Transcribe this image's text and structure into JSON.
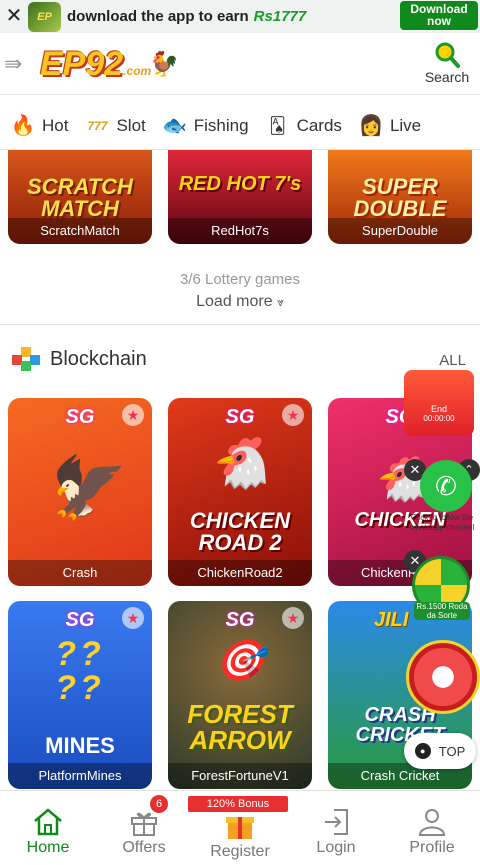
{
  "banner": {
    "close": "✕",
    "app_logo": "EP",
    "text": "download the app to earn",
    "amount": "Rs1777",
    "download": "Download now"
  },
  "header": {
    "logo": "EP92",
    "logo_suffix": ".com",
    "search_label": "Search"
  },
  "categories": [
    {
      "label": "Hot",
      "icon": "flame-icon"
    },
    {
      "label": "Slot",
      "icon": "777-icon"
    },
    {
      "label": "Fishing",
      "icon": "fish-icon"
    },
    {
      "label": "Cards",
      "icon": "cards-icon"
    },
    {
      "label": "Live",
      "icon": "live-dealer-icon"
    }
  ],
  "lottery": {
    "games": [
      {
        "name": "ScratchMatch",
        "art": "SCRATCH MATCH",
        "color": "#c23a0d"
      },
      {
        "name": "RedHot7s",
        "art": "RED HOT 7's",
        "color": "#b5121b"
      },
      {
        "name": "SuperDouble",
        "art": "SUPER DOUBLE",
        "color": "#d04a0a"
      }
    ],
    "count": "3/6 Lottery games",
    "load_more": "Load more"
  },
  "blockchain": {
    "title": "Blockchain",
    "all": "ALL",
    "row1": [
      {
        "name": "Crash",
        "badge": "SG",
        "art": "",
        "color": "#f05a1a"
      },
      {
        "name": "ChickenRoad2",
        "badge": "SG",
        "art": "CHICKEN ROAD 2",
        "color": "#d02a18"
      },
      {
        "name": "ChickenRoad",
        "badge": "SG",
        "art": "CHICKEN",
        "color": "#e0206a"
      }
    ],
    "row2": [
      {
        "name": "PlatformMines",
        "badge": "SG",
        "art": "MINES",
        "color": "#2a6ee0"
      },
      {
        "name": "ForestFortuneV1",
        "badge": "SG",
        "art": "FOREST ARROW",
        "color": "#3a4a3a"
      },
      {
        "name": "Crash Cricket",
        "badge": "JILI",
        "art": "CRASH CRICKET",
        "color": "#1a7ad0"
      }
    ]
  },
  "floating": {
    "red_label": "End",
    "red_time": "00:00:00",
    "whatsapp_text": "Click to follow the whatsapp channel",
    "wheel_text": "Rs.1500 Roda da Sorte",
    "top_label": "TOP"
  },
  "bottomnav": [
    {
      "label": "Home",
      "active": true
    },
    {
      "label": "Offers",
      "badge": "6"
    },
    {
      "label": "Register",
      "bonus": "120% Bonus"
    },
    {
      "label": "Login"
    },
    {
      "label": "Profile"
    }
  ]
}
